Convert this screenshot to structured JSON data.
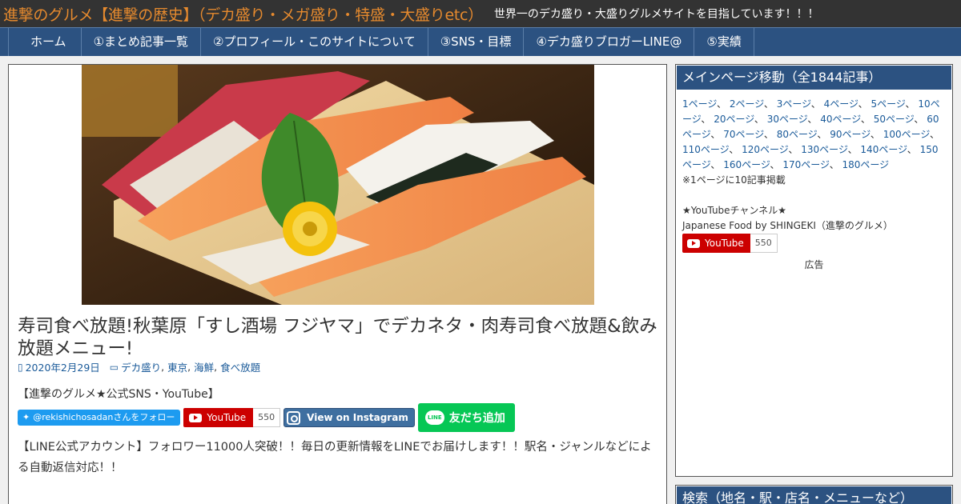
{
  "header": {
    "site_title": "進撃のグルメ【進撃の歴史】（デカ盛り・メガ盛り・特盛・大盛りetc）",
    "tagline": "世界一のデカ盛り・大盛りグルメサイトを目指しています！！！"
  },
  "nav": {
    "items": [
      {
        "label": "ホーム"
      },
      {
        "label": "①まとめ記事一覧"
      },
      {
        "label": "②プロフィール・このサイトについて"
      },
      {
        "label": "③SNS・目標"
      },
      {
        "label": "④デカ盛りブロガーLINE@"
      },
      {
        "label": "⑤実績"
      }
    ]
  },
  "article": {
    "title": "寿司食べ放題!秋葉原「すし酒場 フジヤマ」でデカネタ・肉寿司食べ放題&飲み放題メニュー!",
    "date": "2020年2月29日",
    "categories": [
      "デカ盛り",
      "東京",
      "海鮮",
      "食べ放題"
    ],
    "category_separator": ",",
    "sns_heading": "【進撃のグルメ★公式SNS・YouTube】",
    "twitter_label": "@rekishichosadanさんをフォロー",
    "youtube_label": "YouTube",
    "youtube_count": "550",
    "instagram_label": "View on Instagram",
    "line_logo": "LINE",
    "line_label": "友だち追加",
    "line_text": "【LINE公式アカウント】フォロワー11000人突破！！毎日の更新情報をLINEでお届けします！！駅名・ジャンルなどによる自動返信対応！！"
  },
  "sidebar": {
    "heading": "メインページ移動（全1844記事）",
    "page_links": [
      "1ページ",
      "2ページ",
      "3ページ",
      "4ページ",
      "5ページ",
      "10ページ",
      "20ページ",
      "30ページ",
      "40ページ",
      "50ページ",
      "60ページ",
      "70ページ",
      "80ページ",
      "90ページ",
      "100ページ",
      "110ページ",
      "120ページ",
      "130ページ",
      "140ページ",
      "150ページ",
      "160ページ",
      "170ページ",
      "180ページ"
    ],
    "link_separator": "、",
    "note": "※1ページに10記事掲載",
    "youtube_heading": "★YouTubeチャンネル★",
    "channel_name": "Japanese Food by SHINGEKI（進撃のグルメ）",
    "youtube_label": "YouTube",
    "youtube_count": "550",
    "ad_label": "広告",
    "search_heading": "検索（地名・駅・店名・メニューなど）"
  },
  "colors": {
    "header_bg": "#333333",
    "title_orange": "#e68a2e",
    "nav_bg": "#2c5281",
    "link_blue": "#1a5a99",
    "youtube_red": "#cc0000",
    "line_green": "#06c755",
    "twitter_blue": "#1d9bf0"
  }
}
